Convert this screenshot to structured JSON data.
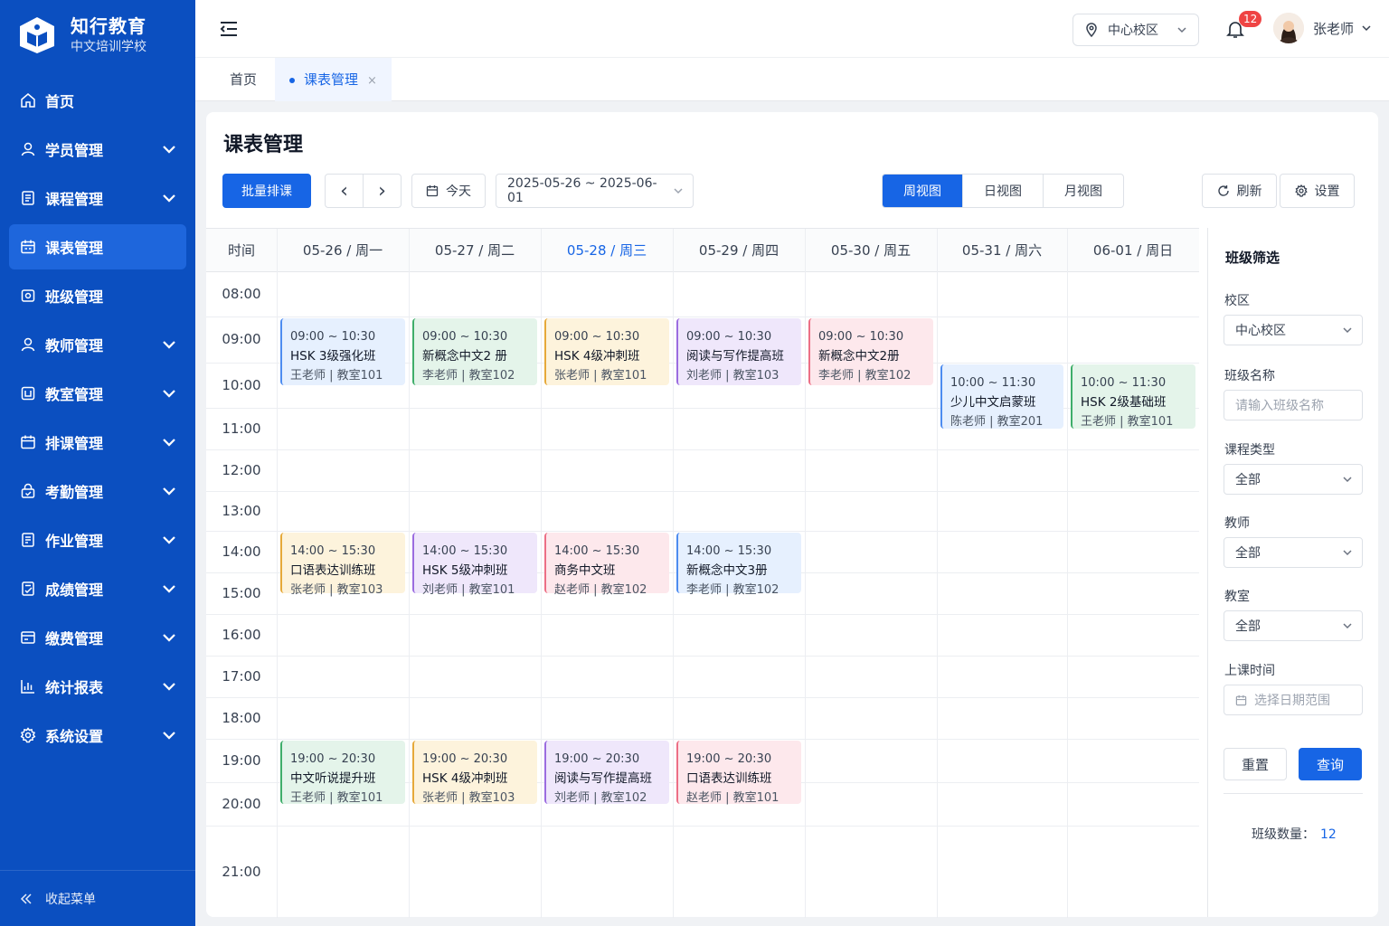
{
  "brand": {
    "title": "知行教育",
    "subtitle": "中文培训学校"
  },
  "sidebar": {
    "items": [
      {
        "label": "首页",
        "icon": "home-icon",
        "has_children": false
      },
      {
        "label": "学员管理",
        "icon": "student-icon",
        "has_children": true
      },
      {
        "label": "课程管理",
        "icon": "course-icon",
        "has_children": true
      },
      {
        "label": "课表管理",
        "icon": "calendar-icon",
        "has_children": false,
        "active": true
      },
      {
        "label": "班级管理",
        "icon": "class-icon",
        "has_children": false
      },
      {
        "label": "教师管理",
        "icon": "teacher-icon",
        "has_children": true
      },
      {
        "label": "教室管理",
        "icon": "classroom-icon",
        "has_children": true
      },
      {
        "label": "排课管理",
        "icon": "schedule-icon",
        "has_children": true
      },
      {
        "label": "考勤管理",
        "icon": "attendance-icon",
        "has_children": true
      },
      {
        "label": "作业管理",
        "icon": "homework-icon",
        "has_children": true
      },
      {
        "label": "成绩管理",
        "icon": "grades-icon",
        "has_children": true
      },
      {
        "label": "缴费管理",
        "icon": "payment-icon",
        "has_children": true
      },
      {
        "label": "统计报表",
        "icon": "chart-icon",
        "has_children": true
      },
      {
        "label": "系统设置",
        "icon": "gear-icon",
        "has_children": true
      }
    ],
    "collapse_label": "收起菜单"
  },
  "header": {
    "campus": "中心校区",
    "notifications": "12",
    "user": "张老师"
  },
  "tabs": {
    "home": "首页",
    "active": "课表管理",
    "close": "×"
  },
  "page": {
    "title": "课表管理"
  },
  "toolbar": {
    "batch": "批量排课",
    "prev": "‹",
    "next": "›",
    "today": "今天",
    "range": "2025-05-26 ~ 2025-06-01",
    "views": [
      "周视图",
      "日视图",
      "月视图"
    ],
    "refresh": "刷新",
    "settings": "设置"
  },
  "calendar": {
    "time_header": "时间",
    "days": [
      "05-26 / 周一",
      "05-27 / 周二",
      "05-28 / 周三",
      "05-29 / 周四",
      "05-30 / 周五",
      "05-31 / 周六",
      "06-01 / 周日"
    ],
    "today_index": 2,
    "hours": [
      "08:00",
      "09:00",
      "10:00",
      "11:00",
      "12:00",
      "13:00",
      "14:00",
      "15:00",
      "16:00",
      "17:00",
      "18:00",
      "19:00",
      "20:00",
      "21:00"
    ],
    "events": [
      {
        "day": 0,
        "time": "09:00 ~ 10:30",
        "name": "HSK 3级强化班",
        "meta": "王老师 | 教室101",
        "color": "blue"
      },
      {
        "day": 1,
        "time": "09:00 ~ 10:30",
        "name": "新概念中文2 册",
        "meta": "李老师 | 教室102",
        "color": "green"
      },
      {
        "day": 2,
        "time": "09:00 ~ 10:30",
        "name": "HSK 4级冲刺班",
        "meta": "张老师 | 教室101",
        "color": "yellow"
      },
      {
        "day": 3,
        "time": "09:00 ~ 10:30",
        "name": "阅读与写作提高班",
        "meta": "刘老师 | 教室103",
        "color": "purple"
      },
      {
        "day": 4,
        "time": "09:00 ~ 10:30",
        "name": "新概念中文2册",
        "meta": "李老师 | 教室102",
        "color": "pink"
      },
      {
        "day": 5,
        "time": "10:00 ~ 11:30",
        "name": "少儿中文启蒙班",
        "meta": "陈老师 | 教室201",
        "color": "blue"
      },
      {
        "day": 6,
        "time": "10:00 ~ 11:30",
        "name": "HSK 2级基础班",
        "meta": "王老师 | 教室101",
        "color": "green"
      },
      {
        "day": 0,
        "time": "14:00 ~ 15:30",
        "name": "口语表达训练班",
        "meta": "张老师 | 教室103",
        "color": "yellow"
      },
      {
        "day": 1,
        "time": "14:00 ~ 15:30",
        "name": "HSK 5级冲刺班",
        "meta": "刘老师 | 教室101",
        "color": "purple"
      },
      {
        "day": 2,
        "time": "14:00 ~ 15:30",
        "name": "商务中文班",
        "meta": "赵老师 | 教室102",
        "color": "pink"
      },
      {
        "day": 3,
        "time": "14:00 ~ 15:30",
        "name": "新概念中文3册",
        "meta": "李老师 | 教室102",
        "color": "blue"
      },
      {
        "day": 0,
        "time": "19:00 ~ 20:30",
        "name": "中文听说提升班",
        "meta": "王老师 | 教室101",
        "color": "green"
      },
      {
        "day": 1,
        "time": "19:00 ~ 20:30",
        "name": "HSK 4级冲刺班",
        "meta": "张老师 | 教室103",
        "color": "yellow"
      },
      {
        "day": 2,
        "time": "19:00 ~ 20:30",
        "name": "阅读与写作提高班",
        "meta": "刘老师 | 教室102",
        "color": "purple"
      },
      {
        "day": 3,
        "time": "19:00 ~ 20:30",
        "name": "口语表达训练班",
        "meta": "赵老师 | 教室101",
        "color": "pink"
      }
    ]
  },
  "filter": {
    "title": "班级筛选",
    "campus_label": "校区",
    "campus_value": "中心校区",
    "class_label": "班级名称",
    "class_placeholder": "请输入班级名称",
    "type_label": "课程类型",
    "type_value": "全部",
    "teacher_label": "教师",
    "teacher_value": "全部",
    "room_label": "教室",
    "room_value": "全部",
    "time_label": "上课时间",
    "time_placeholder": "选择日期范围",
    "reset": "重置",
    "query": "查询",
    "count_label": "班级数量：",
    "count_value": "12"
  }
}
